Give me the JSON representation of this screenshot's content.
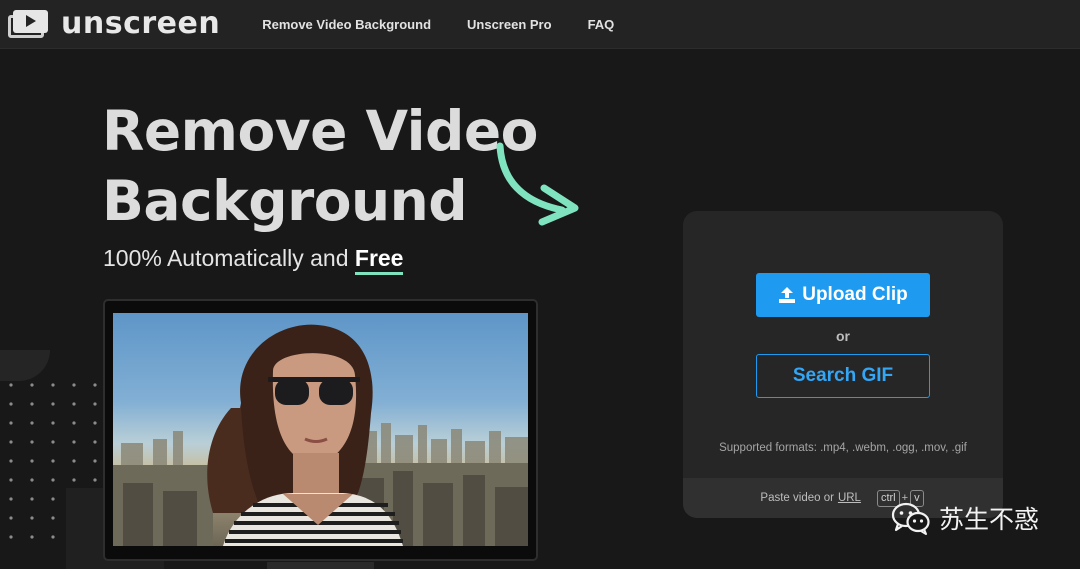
{
  "brand": {
    "name": "unscreen"
  },
  "nav": {
    "links": [
      "Remove Video Background",
      "Unscreen Pro",
      "FAQ"
    ]
  },
  "hero": {
    "title_line1": "Remove Video",
    "title_line2": "Background",
    "subtitle_prefix": "100% Automatically and",
    "subtitle_highlight": "Free"
  },
  "upload": {
    "upload_label": "Upload Clip",
    "or_label": "or",
    "search_label": "Search GIF",
    "formats_text": "Supported formats: .mp4, .webm, .ogg, .mov, .gif",
    "paste_prefix": "Paste video or",
    "paste_url": "URL",
    "key_ctrl": "ctrl",
    "key_plus": "+",
    "key_v": "v"
  },
  "watermark": {
    "text": "苏生不惑"
  },
  "colors": {
    "background": "#181818",
    "navbar": "#232323",
    "accent_blue": "#1e9bf0",
    "highlight_green": "#7fe3c0",
    "panel": "#262626"
  },
  "icons": [
    "logo-icon",
    "upload-icon",
    "curved-arrow-icon",
    "wechat-icon"
  ]
}
